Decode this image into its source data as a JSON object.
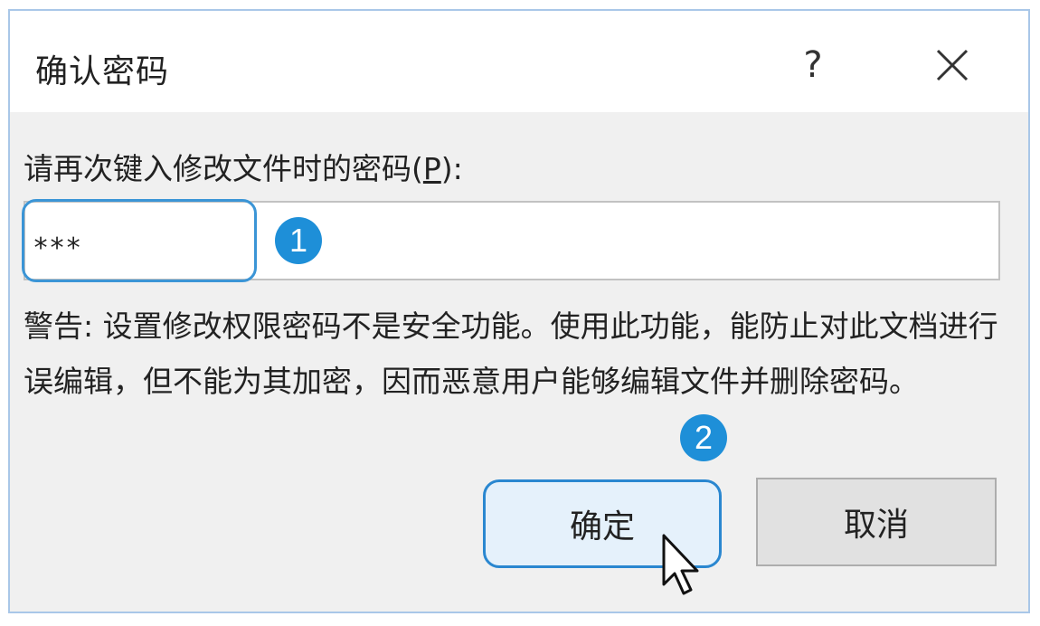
{
  "dialog": {
    "title": "确认密码",
    "help_label": "?",
    "prompt_text": "请再次键入修改文件时的密码(",
    "prompt_accel": "P",
    "prompt_suffix": "):",
    "password_value": "***",
    "warning_text": "警告: 设置修改权限密码不是安全功能。使用此功能，能防止对此文档进行误编辑，但不能为其加密，因而恶意用户能够编辑文件并删除密码。",
    "ok_label": "确定",
    "cancel_label": "取消"
  },
  "annotations": {
    "step1": "1",
    "step2": "2",
    "accent_color": "#1e8fd8"
  },
  "icons": {
    "close": "close-icon",
    "cursor": "mouse-pointer-icon"
  }
}
